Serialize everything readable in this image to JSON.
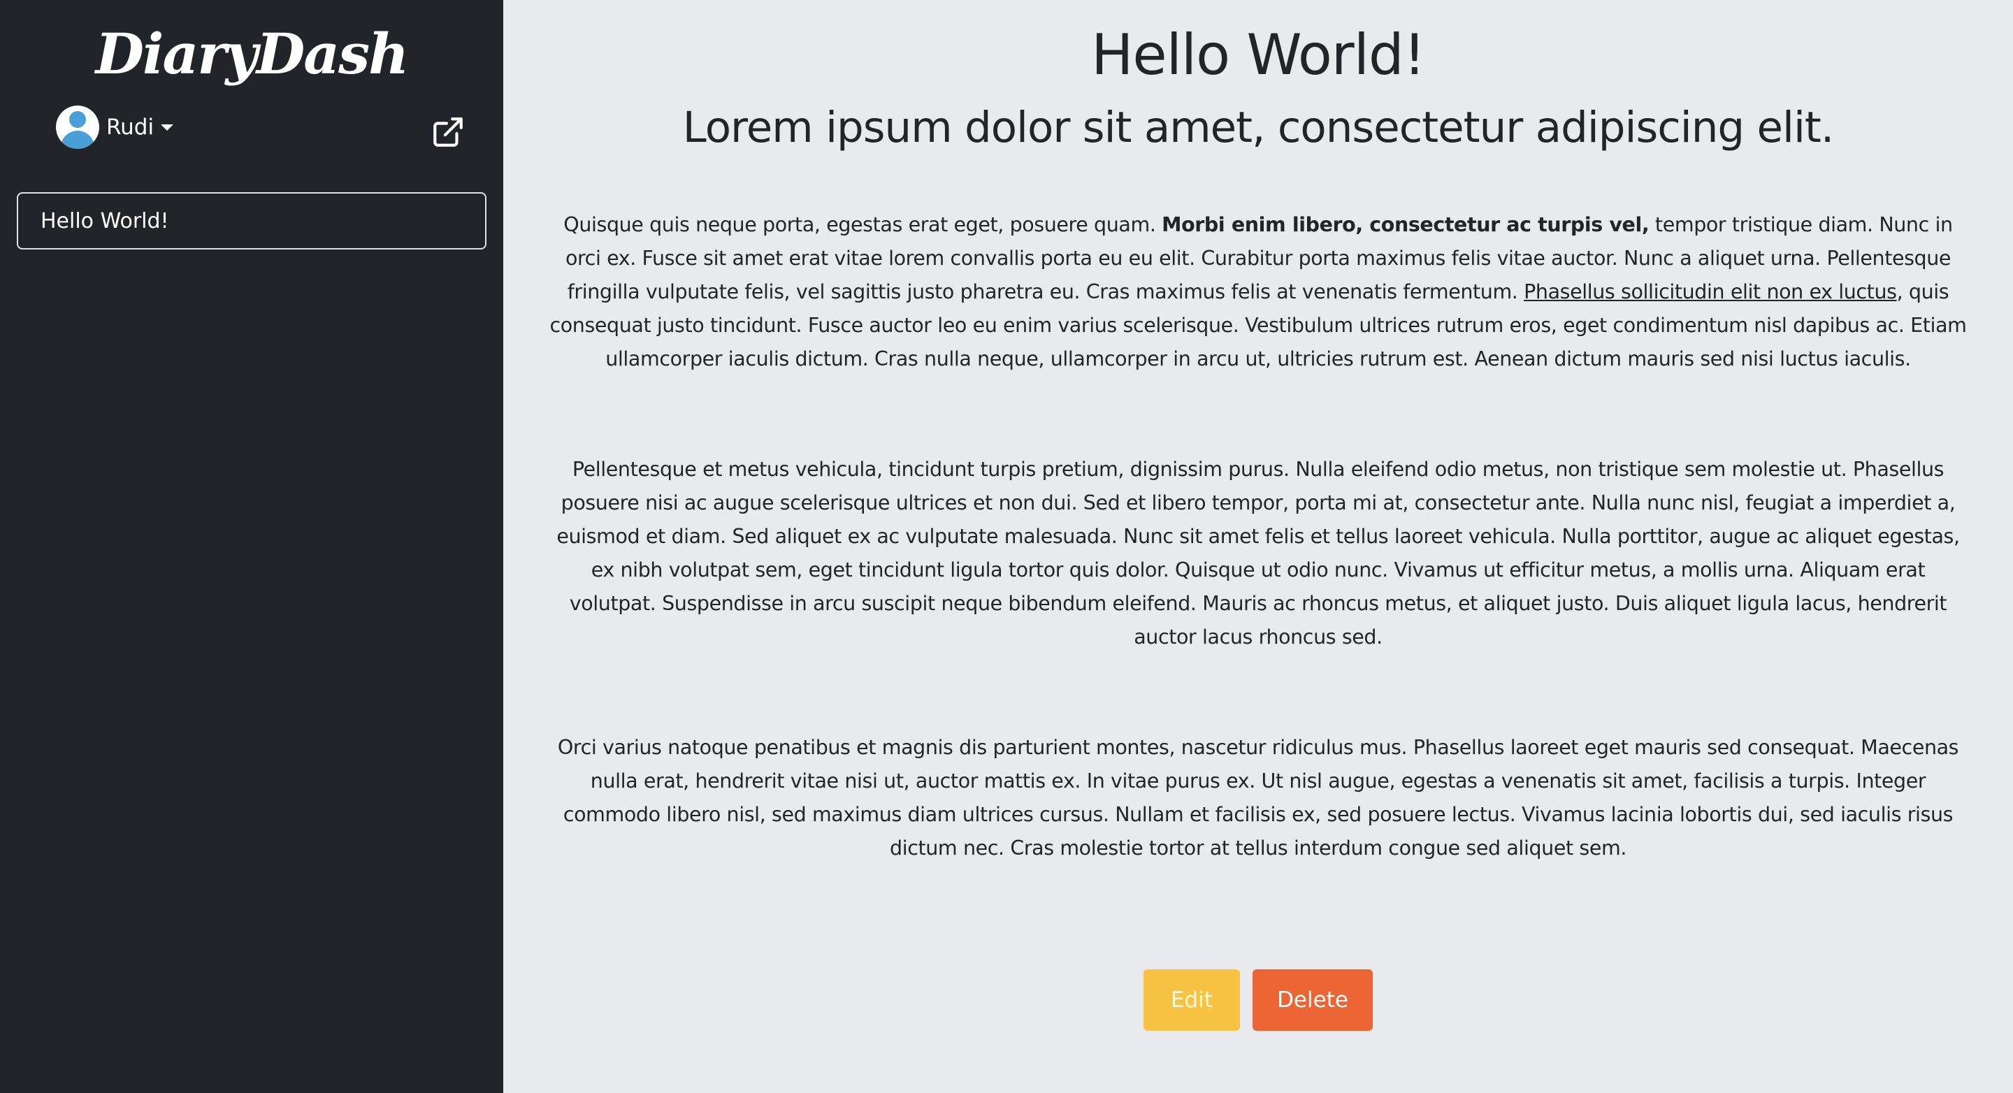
{
  "sidebar": {
    "brand": "DiaryDash",
    "user": {
      "name": "Rudi"
    },
    "entries": [
      {
        "label": "Hello World!"
      }
    ]
  },
  "entry": {
    "title": "Hello World!",
    "subtitle": "Lorem ipsum dolor sit amet, consectetur adipiscing elit.",
    "p1": {
      "a": "Quisque quis neque porta, egestas erat eget, posuere quam. ",
      "bold": "Morbi enim libero, consectetur ac turpis vel,",
      "b": " tempor tristique diam. Nunc in orci ex. Fusce sit amet erat vitae lorem convallis porta eu eu elit. Curabitur porta maximus felis vitae auctor. Nunc a aliquet urna. Pellentesque fringilla vulputate felis, vel sagittis justo pharetra eu. Cras maximus felis at venenatis fermentum. ",
      "underline": "Phasellus sollicitudin elit non ex luctus",
      "c": ", quis consequat justo tincidunt. Fusce auctor leo eu enim varius scelerisque. Vestibulum ultrices rutrum eros, eget condimentum nisl dapibus ac. Etiam ullamcorper iaculis dictum. Cras nulla neque, ullamcorper in arcu ut, ultricies rutrum est. Aenean dictum mauris sed nisi luctus iaculis."
    },
    "p2": "Pellentesque et metus vehicula, tincidunt turpis pretium, dignissim purus. Nulla eleifend odio metus, non tristique sem molestie ut. Phasellus posuere nisi ac augue scelerisque ultrices et non dui. Sed et libero tempor, porta mi at, consectetur ante. Nulla nunc nisl, feugiat a imperdiet a, euismod et diam. Sed aliquet ex ac vulputate malesuada. Nunc sit amet felis et tellus laoreet vehicula. Nulla porttitor, augue ac aliquet egestas, ex nibh volutpat sem, eget tincidunt ligula tortor quis dolor. Quisque ut odio nunc. Vivamus ut efficitur metus, a mollis urna. Aliquam erat volutpat. Suspendisse in arcu suscipit neque bibendum eleifend. Mauris ac rhoncus metus, et aliquet justo. Duis aliquet ligula lacus, hendrerit auctor lacus rhoncus sed.",
    "p3": "Orci varius natoque penatibus et magnis dis parturient montes, nascetur ridiculus mus. Phasellus laoreet eget mauris sed consequat. Maecenas nulla erat, hendrerit vitae nisi ut, auctor mattis ex. In vitae purus ex. Ut nisl augue, egestas a venenatis sit amet, facilisis a turpis. Integer commodo libero nisl, sed maximus diam ultrices cursus. Nullam et facilisis ex, sed posuere lectus. Vivamus lacinia lobortis dui, sed iaculis risus dictum nec. Cras molestie tortor at tellus interdum congue sed aliquet sem."
  },
  "actions": {
    "edit_label": "Edit",
    "delete_label": "Delete"
  },
  "colors": {
    "sidebar_bg": "#212529",
    "main_bg": "#e9eaee",
    "edit": "#f6c342",
    "delete": "#ec6535",
    "avatar": "#4a9fd8"
  },
  "icons": {
    "user": "user-avatar-icon",
    "dropdown": "caret-down-icon",
    "external": "external-link-icon"
  }
}
